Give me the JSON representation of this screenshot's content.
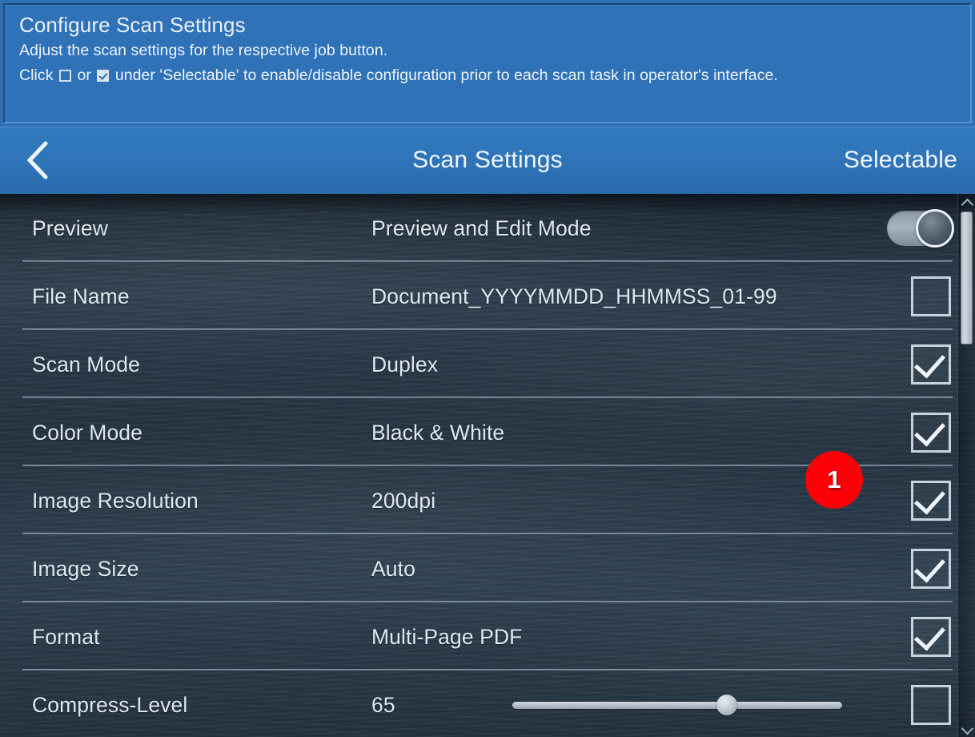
{
  "banner": {
    "title": "Configure Scan Settings",
    "line1": "Adjust the scan settings for the respective job button.",
    "line2_a": "Click",
    "line2_b": "or",
    "line2_c": "under 'Selectable' to enable/disable configuration prior to each scan task in operator's interface."
  },
  "titlebar": {
    "back_icon": "chevron-left-icon",
    "title": "Scan Settings",
    "right_label": "Selectable"
  },
  "badge": {
    "value": "1",
    "color": "#fb0006"
  },
  "colors": {
    "accent_blue": "#2f72b8",
    "titlebar_blue": "#3279bd",
    "list_background": "#2a3a49",
    "text": "#dfe7ef",
    "control_border": "#c8d3de"
  },
  "rows": [
    {
      "label": "Preview",
      "value": "Preview and Edit Mode",
      "control": "toggle",
      "toggle_on": true
    },
    {
      "label": "File Name",
      "value": "Document_YYYYMMDD_HHMMSS_01-99",
      "control": "checkbox",
      "checked": false
    },
    {
      "label": "Scan Mode",
      "value": "Duplex",
      "control": "checkbox",
      "checked": true
    },
    {
      "label": "Color Mode",
      "value": "Black & White",
      "control": "checkbox",
      "checked": true
    },
    {
      "label": "Image Resolution",
      "value": "200dpi",
      "control": "checkbox",
      "checked": true
    },
    {
      "label": "Image Size",
      "value": "Auto",
      "control": "checkbox",
      "checked": true
    },
    {
      "label": "Format",
      "value": "Multi-Page PDF",
      "control": "checkbox",
      "checked": true
    },
    {
      "label": "Compress-Level",
      "value": "65",
      "control": "slider",
      "checked": false,
      "slider_percent": 65
    }
  ],
  "scrollbar": {
    "up_icon": "chevron-up-icon",
    "down_icon": "chevron-down-icon"
  }
}
